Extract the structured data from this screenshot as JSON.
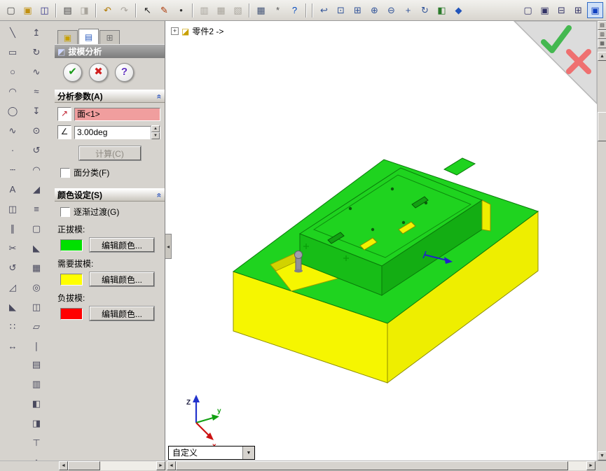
{
  "colors": {
    "positive_draft": "#00E000",
    "requires_draft": "#FFFF00",
    "negative_draft": "#FF0000",
    "selection_highlight": "#F09E9E",
    "accent_blue": "#316AC5"
  },
  "toolbar_top": {
    "icons": [
      {
        "name": "new-document-button",
        "glyph": "▢",
        "color": "#444444"
      },
      {
        "name": "open-document-button",
        "glyph": "▣",
        "color": "#c09010"
      },
      {
        "name": "save-button",
        "glyph": "◫",
        "color": "#35358a"
      },
      {
        "sep": true
      },
      {
        "name": "print-button",
        "glyph": "▤",
        "color": "#444444"
      },
      {
        "name": "print-preview-button",
        "glyph": "◨",
        "disabled": true
      },
      {
        "sep": true
      },
      {
        "name": "undo-button",
        "glyph": "↶",
        "color": "#b07800"
      },
      {
        "name": "redo-button",
        "glyph": "↷",
        "disabled": true
      },
      {
        "sep": true
      },
      {
        "name": "select-tool-button",
        "glyph": "↖",
        "color": "#222222"
      },
      {
        "name": "sketch-button",
        "glyph": "✎",
        "color": "#aa3300"
      },
      {
        "name": "sketch-point-button",
        "glyph": "•",
        "color": "#333333"
      },
      {
        "sep": true
      },
      {
        "name": "make-drawing-button",
        "glyph": "▥",
        "disabled": true
      },
      {
        "name": "make-assembly-button",
        "glyph": "▦",
        "disabled": true
      },
      {
        "name": "insert-table-button",
        "glyph": "▧",
        "disabled": true
      },
      {
        "sep": true
      },
      {
        "name": "grid-settings-button",
        "glyph": "▦",
        "color": "#445577"
      },
      {
        "name": "options-button",
        "glyph": "*",
        "color": "#555555"
      },
      {
        "name": "help-button",
        "glyph": "?",
        "color": "#0048c0"
      },
      {
        "sep": true
      },
      {
        "sep": true
      },
      {
        "name": "previous-view-button",
        "glyph": "↩",
        "color": "#335599"
      },
      {
        "name": "zoom-to-fit-button",
        "glyph": "⊡",
        "color": "#335599"
      },
      {
        "name": "zoom-to-area-button",
        "glyph": "⊞",
        "color": "#335599"
      },
      {
        "name": "zoom-in-out-button",
        "glyph": "⊕",
        "color": "#335599"
      },
      {
        "name": "zoom-out-button",
        "glyph": "⊖",
        "color": "#335599"
      },
      {
        "name": "pan-button",
        "glyph": "+",
        "color": "#335599"
      },
      {
        "name": "rotate-view-button",
        "glyph": "↻",
        "color": "#335599"
      },
      {
        "name": "shaded-display-button",
        "glyph": "◧",
        "color": "#2a7a2a"
      },
      {
        "name": "display-style-button",
        "glyph": "◆",
        "color": "#2255bb"
      },
      {
        "spacer": true
      },
      {
        "name": "window-new-button",
        "glyph": "▢",
        "color": "#333366"
      },
      {
        "name": "window-cascade-button",
        "glyph": "▣",
        "color": "#333366"
      },
      {
        "name": "window-tile-horizontal-button",
        "glyph": "⊟",
        "color": "#333366"
      },
      {
        "name": "window-tile-vertical-button",
        "glyph": "⊞",
        "color": "#333366"
      },
      {
        "name": "active-window-button",
        "glyph": "▣",
        "color": "#1040c0",
        "active": true
      }
    ]
  },
  "left_toolbar": {
    "column1": [
      {
        "name": "sketch-line-tool",
        "glyph": "╲"
      },
      {
        "name": "sketch-rectangle-tool",
        "glyph": "▭"
      },
      {
        "name": "sketch-circle-tool",
        "glyph": "○"
      },
      {
        "name": "sketch-arc-tool",
        "glyph": "◠"
      },
      {
        "name": "sketch-ellipse-tool",
        "glyph": "◯"
      },
      {
        "name": "sketch-spline-tool",
        "glyph": "∿"
      },
      {
        "name": "sketch-point-tool",
        "glyph": "·"
      },
      {
        "name": "sketch-centerline-tool",
        "glyph": "┄"
      },
      {
        "name": "sketch-text-tool",
        "glyph": "A"
      },
      {
        "name": "mirror-entities-tool",
        "glyph": "◫"
      },
      {
        "name": "offset-entities-tool",
        "glyph": "∥"
      },
      {
        "name": "trim-entities-tool",
        "glyph": "✂"
      },
      {
        "name": "convert-entities-tool",
        "glyph": "↺"
      },
      {
        "name": "sketch-fillet-tool",
        "glyph": "◿"
      },
      {
        "name": "sketch-chamfer-tool",
        "glyph": "◣"
      },
      {
        "name": "sketch-pattern-tool",
        "glyph": "∷"
      },
      {
        "name": "smart-dimension-tool",
        "glyph": "↔"
      }
    ],
    "column2": [
      {
        "name": "extruded-boss-tool",
        "glyph": "↥"
      },
      {
        "name": "revolved-boss-tool",
        "glyph": "↻"
      },
      {
        "name": "swept-boss-tool",
        "glyph": "∿"
      },
      {
        "name": "lofted-boss-tool",
        "glyph": "≈"
      },
      {
        "name": "extruded-cut-tool",
        "glyph": "↧"
      },
      {
        "name": "hole-wizard-tool",
        "glyph": "⊙"
      },
      {
        "name": "revolved-cut-tool",
        "glyph": "↺"
      },
      {
        "name": "fillet-feature-tool",
        "glyph": "◠"
      },
      {
        "name": "chamfer-feature-tool",
        "glyph": "◢"
      },
      {
        "name": "rib-feature-tool",
        "glyph": "≡"
      },
      {
        "name": "shell-feature-tool",
        "glyph": "▢"
      },
      {
        "name": "draft-feature-tool",
        "glyph": "◣"
      },
      {
        "name": "linear-pattern-tool",
        "glyph": "▦"
      },
      {
        "name": "circular-pattern-tool",
        "glyph": "◎"
      },
      {
        "name": "mirror-feature-tool",
        "glyph": "◫"
      },
      {
        "name": "reference-plane-tool",
        "glyph": "▱"
      },
      {
        "name": "reference-axis-tool",
        "glyph": "∣"
      }
    ],
    "column2_lower": [
      {
        "name": "view-front-button",
        "glyph": "▤"
      },
      {
        "name": "view-back-button",
        "glyph": "▥"
      },
      {
        "name": "view-left-button",
        "glyph": "◧"
      },
      {
        "name": "view-right-button",
        "glyph": "◨"
      },
      {
        "name": "view-top-button",
        "glyph": "⊤"
      },
      {
        "name": "view-isometric-button",
        "glyph": "◇"
      }
    ]
  },
  "panel": {
    "tabs": [
      {
        "name": "featuremanager-tab",
        "glyph": "▣"
      },
      {
        "name": "propertymanager-tab",
        "glyph": "▤"
      },
      {
        "name": "configurationmanager-tab",
        "glyph": "⊞"
      }
    ],
    "title_icon": "◩",
    "title": "拔模分析",
    "ok_glyph": "✔",
    "cancel_glyph": "✖",
    "help_glyph": "?",
    "collapse_glyph": "«",
    "analysis": {
      "header": "分析参数(A)",
      "direction_icon_glyph": "↗",
      "selection_value": "面<1>",
      "angle_icon_glyph": "∠",
      "angle_value": "3.00deg",
      "calculate_label": "计算(C)",
      "face_classification_label": "面分类(F)"
    },
    "color_settings": {
      "header": "颜色设定(S)",
      "gradual_label": "逐渐过渡(G)",
      "positive_label": "正拔模:",
      "requires_label": "需要拔模:",
      "negative_label": "负拔模:",
      "edit_color_label": "编辑颜色..."
    }
  },
  "viewport": {
    "tree_item": "零件2 ->",
    "custom_combo": "自定义",
    "triad": {
      "z": "Z",
      "y": "y",
      "x": "x"
    }
  }
}
